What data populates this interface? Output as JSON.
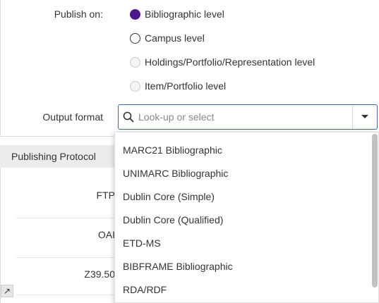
{
  "publish": {
    "label": "Publish on:",
    "options": [
      {
        "label": "Bibliographic level",
        "state": "checked"
      },
      {
        "label": "Campus level",
        "state": "unchecked"
      },
      {
        "label": "Holdings/Portfolio/Representation level",
        "state": "disabled"
      },
      {
        "label": "Item/Portfolio level",
        "state": "disabled"
      }
    ]
  },
  "output_format": {
    "label": "Output format",
    "placeholder": "Look-up or select",
    "value": ""
  },
  "protocol": {
    "header": "Publishing Protocol",
    "labels": [
      "FTP",
      "OAI",
      "Z39.50"
    ],
    "expand_glyph": "↗"
  },
  "dropdown": {
    "options": [
      "MARC21 Bibliographic",
      "UNIMARC Bibliographic",
      "Dublin Core (Simple)",
      "Dublin Core (Qualified)",
      "ETD-MS",
      "BIBFRAME Bibliographic",
      "RDA/RDF"
    ]
  },
  "colors": {
    "accent": "#4a1a8c",
    "focus_border": "#3f6ba6"
  }
}
